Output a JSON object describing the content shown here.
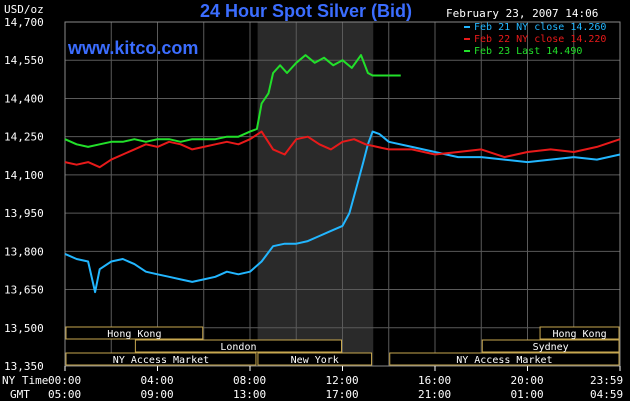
{
  "header": {
    "unit": "USD/oz",
    "title": "24 Hour Spot Silver (Bid)",
    "timestamp": "February 23, 2007 14:06",
    "brand": "www.kitco.com"
  },
  "colors": {
    "background": "#000000",
    "grid": "#5a5a5a",
    "title": "#3b6dff",
    "session_band": "#2a2a2a",
    "feb21": "#22b6ff",
    "feb22": "#e81a1a",
    "feb23": "#22e02a",
    "market_border": "#c8a850",
    "market_text": "#ffffff"
  },
  "legend": [
    {
      "label": "Feb 21 NY close 14.260",
      "color": "#22b6ff"
    },
    {
      "label": "Feb 22 NY close 14.220",
      "color": "#e81a1a"
    },
    {
      "label": "Feb 23 Last 14.490",
      "color": "#22e02a"
    }
  ],
  "markets": {
    "row1": [
      {
        "name": "Hong Kong",
        "start": 0,
        "end": 6
      },
      {
        "name": "Hong Kong",
        "start": 20.5,
        "end": 24
      }
    ],
    "row2": [
      {
        "name": "London",
        "start": 3,
        "end": 12
      },
      {
        "name": "Sydney",
        "start": 18,
        "end": 24
      }
    ],
    "row3": [
      {
        "name": "NY Access Market",
        "start": 0,
        "end": 8.3
      },
      {
        "name": "New York",
        "start": 8.3,
        "end": 13.3
      },
      {
        "name": "NY Access Market",
        "start": 14,
        "end": 24
      }
    ]
  },
  "time_axis": {
    "ny_label": "NY Time",
    "gmt_label": "GMT",
    "ny_ticks": [
      "00:00",
      "04:00",
      "08:00",
      "12:00",
      "16:00",
      "20:00",
      "23:59"
    ],
    "gmt_ticks": [
      "05:00",
      "09:00",
      "13:00",
      "17:00",
      "21:00",
      "01:00",
      "04:59"
    ]
  },
  "chart_data": {
    "type": "line",
    "title": "24 Hour Spot Silver (Bid)",
    "ylabel": "USD/oz",
    "xlabel": "NY Time / GMT",
    "ylim": [
      13.35,
      14.7
    ],
    "y_ticks": [
      13.35,
      13.5,
      13.65,
      13.8,
      13.95,
      14.1,
      14.25,
      14.4,
      14.55,
      14.7
    ],
    "y_tick_labels": [
      "13,350",
      "13,500",
      "13,650",
      "13,800",
      "13,950",
      "14,100",
      "14,250",
      "14,400",
      "14,550",
      "14,700"
    ],
    "x_range_hours": [
      0,
      24
    ],
    "grid": true,
    "legend_position": "top-right",
    "highlight_band_hours": [
      8.33,
      13.33
    ],
    "series": [
      {
        "name": "Feb 21 NY close 14.260",
        "color": "#22b6ff",
        "x": [
          0,
          0.5,
          1,
          1.3,
          1.5,
          2,
          2.5,
          3,
          3.5,
          4,
          4.5,
          5,
          5.5,
          6,
          6.5,
          7,
          7.5,
          8,
          8.5,
          9,
          9.5,
          10,
          10.5,
          11,
          11.5,
          12,
          12.3,
          12.6,
          12.9,
          13.1,
          13.3,
          13.6,
          14,
          15,
          16,
          17,
          18,
          19,
          20,
          21,
          22,
          23,
          24
        ],
        "y": [
          13.79,
          13.77,
          13.76,
          13.64,
          13.73,
          13.76,
          13.77,
          13.75,
          13.72,
          13.71,
          13.7,
          13.69,
          13.68,
          13.69,
          13.7,
          13.72,
          13.71,
          13.72,
          13.76,
          13.82,
          13.83,
          13.83,
          13.84,
          13.86,
          13.88,
          13.9,
          13.95,
          14.05,
          14.15,
          14.22,
          14.27,
          14.26,
          14.23,
          14.21,
          14.19,
          14.17,
          14.17,
          14.16,
          14.15,
          14.16,
          14.17,
          14.16,
          14.18
        ]
      },
      {
        "name": "Feb 22 NY close 14.220",
        "color": "#e81a1a",
        "x": [
          0,
          0.5,
          1,
          1.5,
          2,
          2.5,
          3,
          3.5,
          4,
          4.5,
          5,
          5.5,
          6,
          6.5,
          7,
          7.5,
          8,
          8.5,
          9,
          9.5,
          10,
          10.5,
          11,
          11.5,
          12,
          12.5,
          13,
          13.5,
          14,
          15,
          16,
          17,
          18,
          19,
          20,
          21,
          22,
          23,
          24
        ],
        "y": [
          14.15,
          14.14,
          14.15,
          14.13,
          14.16,
          14.18,
          14.2,
          14.22,
          14.21,
          14.23,
          14.22,
          14.2,
          14.21,
          14.22,
          14.23,
          14.22,
          14.24,
          14.27,
          14.2,
          14.18,
          14.24,
          14.25,
          14.22,
          14.2,
          14.23,
          14.24,
          14.22,
          14.21,
          14.2,
          14.2,
          14.18,
          14.19,
          14.2,
          14.17,
          14.19,
          14.2,
          14.19,
          14.21,
          14.24
        ]
      },
      {
        "name": "Feb 23 Last 14.490",
        "color": "#22e02a",
        "x": [
          0,
          0.5,
          1,
          1.5,
          2,
          2.5,
          3,
          3.5,
          4,
          4.5,
          5,
          5.5,
          6,
          6.5,
          7,
          7.5,
          8,
          8.3,
          8.5,
          8.8,
          9,
          9.3,
          9.6,
          10,
          10.4,
          10.8,
          11.2,
          11.6,
          12,
          12.4,
          12.8,
          13.1,
          13.3,
          13.5,
          13.7,
          14
        ],
        "y": [
          14.24,
          14.22,
          14.21,
          14.22,
          14.23,
          14.23,
          14.24,
          14.23,
          14.24,
          14.24,
          14.23,
          14.24,
          14.24,
          14.24,
          14.25,
          14.25,
          14.27,
          14.28,
          14.38,
          14.42,
          14.5,
          14.53,
          14.5,
          14.54,
          14.57,
          14.54,
          14.56,
          14.53,
          14.55,
          14.52,
          14.57,
          14.5,
          14.49,
          14.49,
          14.49,
          14.49
        ]
      }
    ]
  }
}
